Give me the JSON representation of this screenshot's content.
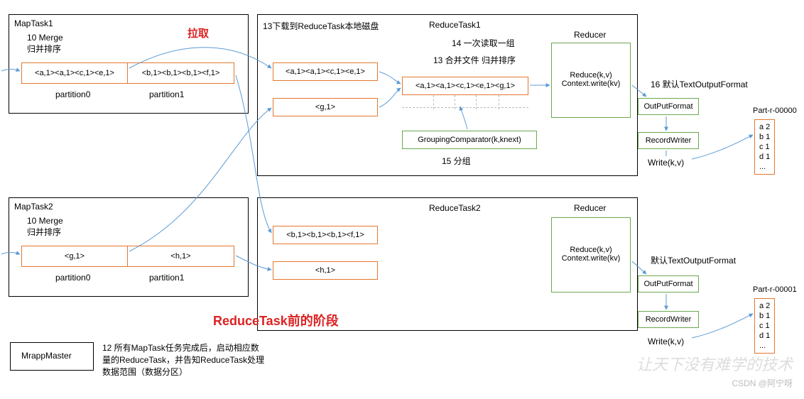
{
  "maptask1": {
    "title": "MapTask1",
    "merge_label": "10 Merge\n归并排序",
    "partition0": "<a,1><a,1><c,1><e,1>",
    "partition1": "<b,1><b,1><b,1><f,1>",
    "p0_label": "partition0",
    "p1_label": "partition1"
  },
  "maptask2": {
    "title": "MapTask2",
    "merge_label": "10 Merge\n归并排序",
    "partition0": "<g,1>",
    "partition1": "<h,1>",
    "p0_label": "partition0",
    "p1_label": "partition1"
  },
  "pull_label": "拉取",
  "phase_label": "ReduceTask前的阶段",
  "mrapp": {
    "title": "MrappMaster",
    "desc": "12 所有MapTask任务完成后，启动相应数量的ReduceTask，并告知ReduceTask处理数据范围（数据分区）"
  },
  "reducetask1": {
    "title": "ReduceTask1",
    "step13_download": "13下载到ReduceTask本地磁盘",
    "local1": "<a,1><a,1><c,1><e,1>",
    "local2": "<g,1>",
    "step14": "14 一次读取一组",
    "step13_merge": "13 合并文件 归并排序",
    "merged": "<a,1><a,1><c,1><e,1><g,1>",
    "grouping": "GroupingComparator(k,knext)",
    "step15": "15 分组",
    "reducer_title": "Reducer",
    "reducer_body": "Reduce(k,v)\nContext.write(kv)",
    "step16": "16 默认TextOutputFormat",
    "outputformat": "OutPutFormat",
    "recordwriter": "RecordWriter",
    "write": "Write(k,v)",
    "outfile": "Part-r-00000",
    "outdata": "a 2\nb 1\nc 1\nd 1\n..."
  },
  "reducetask2": {
    "title": "ReduceTask2",
    "local1": "<b,1><b,1><b,1><f,1>",
    "local2": "<h,1>",
    "reducer_title": "Reducer",
    "reducer_body": "Reduce(k,v)\nContext.write(kv)",
    "default": "默认TextOutputFormat",
    "outputformat": "OutPutFormat",
    "recordwriter": "RecordWriter",
    "write": "Write(k,v)",
    "outfile": "Part-r-00001",
    "outdata": "a 2\nb 1\nc 1\nd 1\n..."
  },
  "watermark": {
    "a": "让天下没有难学的技术",
    "b": "CSDN @阿宁呀"
  }
}
